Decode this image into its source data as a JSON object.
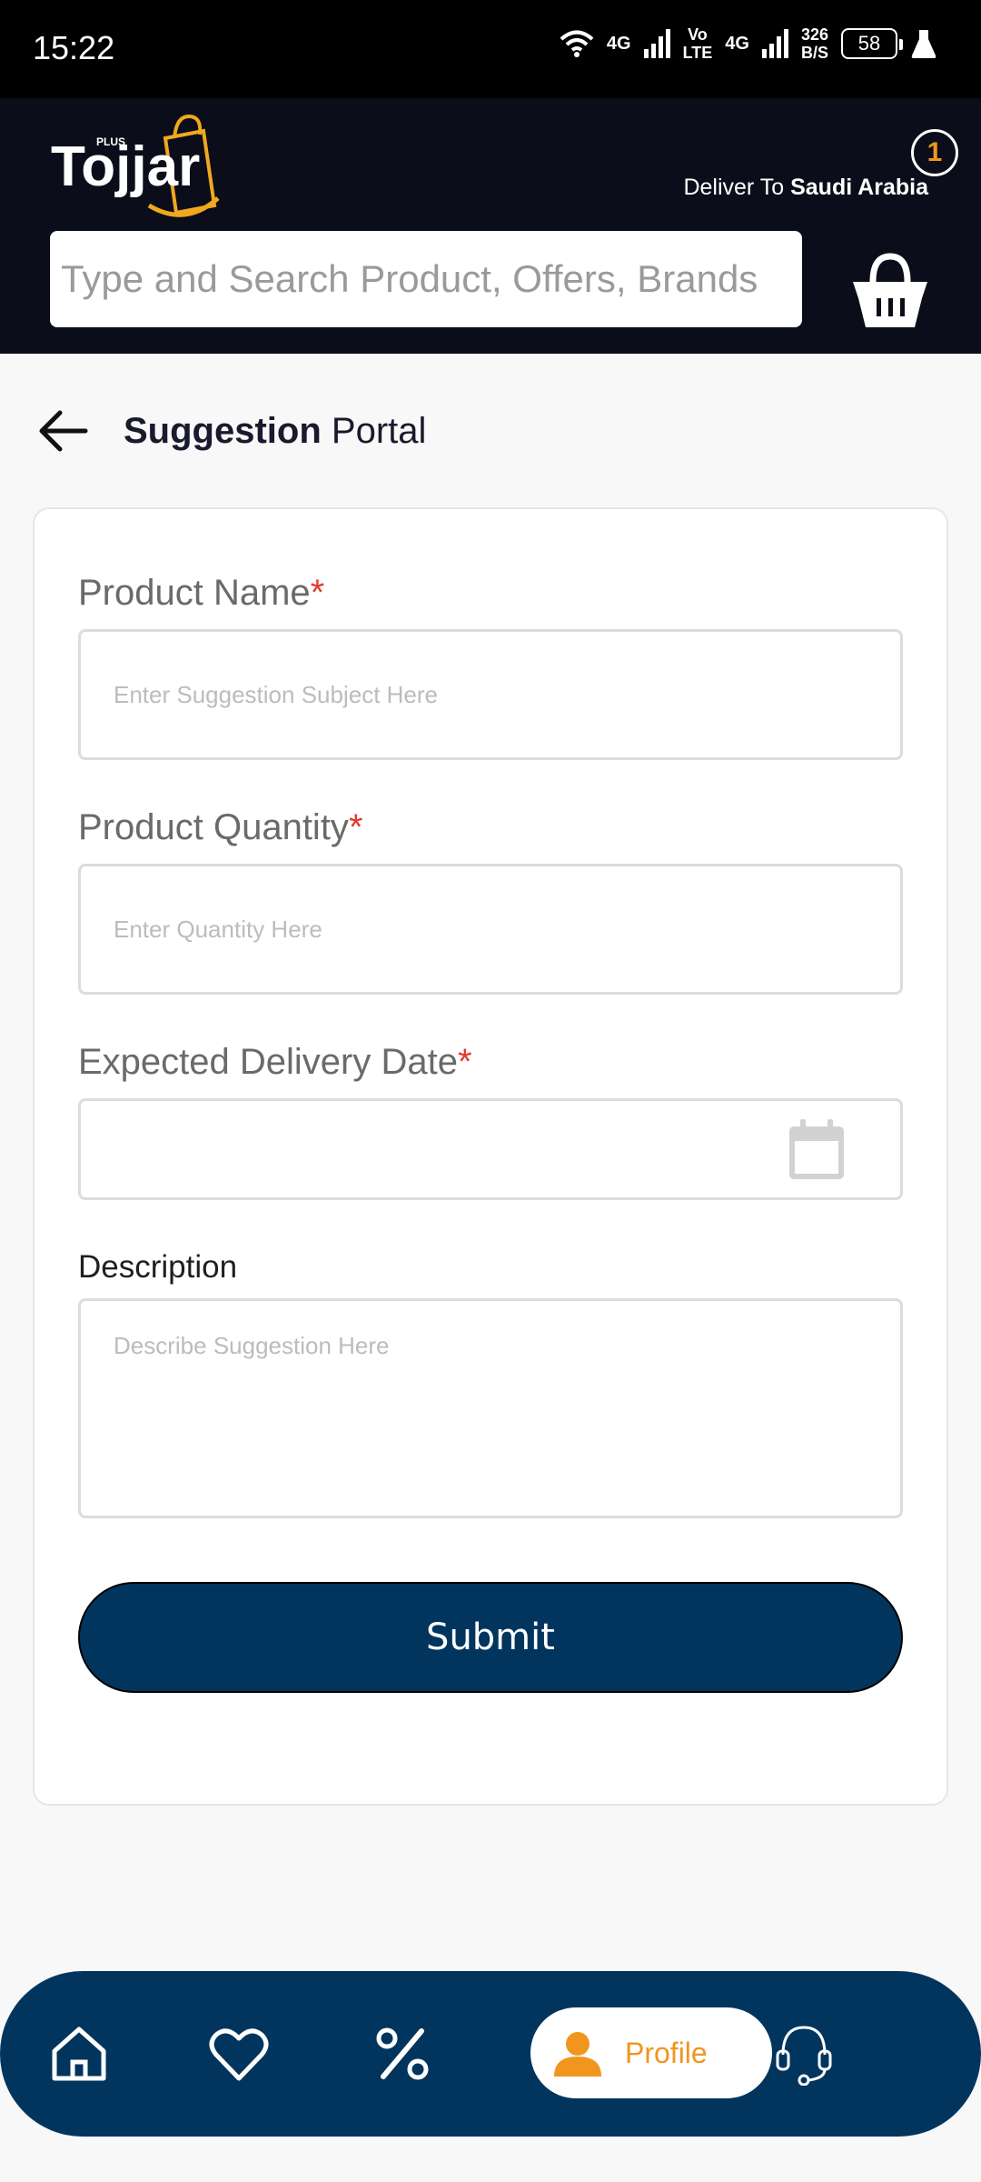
{
  "status_bar": {
    "time": "15:22",
    "net1": "4G",
    "volte_top": "Vo",
    "volte_bottom": "LTE",
    "net2": "4G",
    "speed_value": "326",
    "speed_unit": "B/S",
    "battery": "58"
  },
  "header": {
    "logo_text": "Tojjar",
    "logo_sub": "PLUS",
    "deliver_prefix": "Deliver To",
    "deliver_country": "Saudi Arabia",
    "search_placeholder": "Type and Search Product, Offers, Brands",
    "cart_count": "1"
  },
  "page": {
    "title_bold": "Suggestion",
    "title_rest": "Portal"
  },
  "form": {
    "product_name_label": "Product Name",
    "product_name_placeholder": "Enter Suggestion Subject Here",
    "quantity_label": "Product Quantity",
    "quantity_placeholder": "Enter Quantity Here",
    "date_label": "Expected Delivery Date",
    "required_mark": "*",
    "description_label": "Description",
    "description_placeholder": "Describe Suggestion Here",
    "submit_label": "Submit"
  },
  "bottom_nav": {
    "items": [
      "home-icon",
      "heart-icon",
      "percent-icon",
      "profile-icon",
      "support-icon"
    ],
    "active_label": "Profile"
  },
  "colors": {
    "accent": "#f0961e",
    "primary": "#02355e",
    "header_bg": "#0b0e1a",
    "required": "#e03b2c"
  }
}
